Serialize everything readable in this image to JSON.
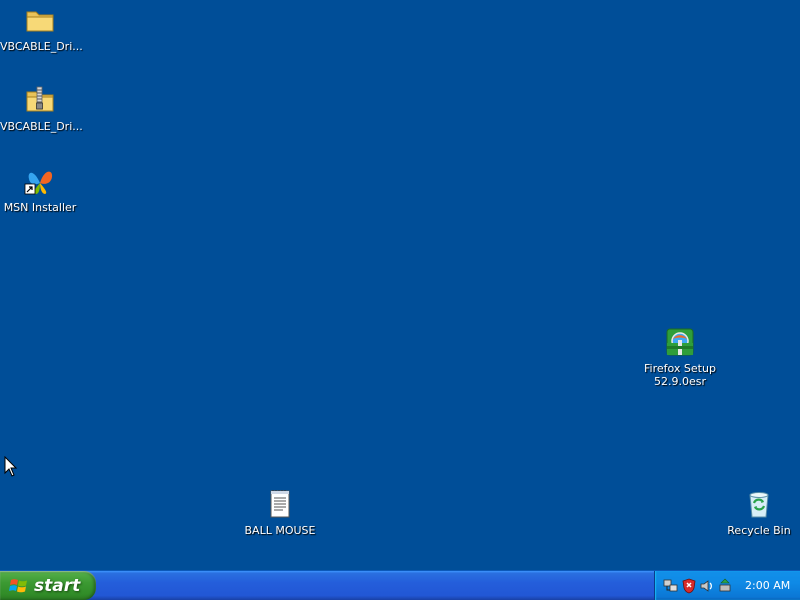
{
  "desktop": {
    "background_color": "#004e98",
    "icons": [
      {
        "label": "VBCABLE_Dri...",
        "icon": "folder-icon"
      },
      {
        "label": "VBCABLE_Dri...",
        "icon": "zip-folder-icon"
      },
      {
        "label": "MSN Installer",
        "icon": "msn-butterfly-shortcut-icon"
      },
      {
        "label": "Firefox Setup\n52.9.0esr",
        "icon": "installer-package-icon"
      },
      {
        "label": "BALL MOUSE",
        "icon": "text-document-icon"
      },
      {
        "label": "Recycle Bin",
        "icon": "recycle-bin-icon"
      }
    ]
  },
  "taskbar": {
    "start_label": "start",
    "clock": "2:00 AM",
    "tray_icons": [
      "network-icon",
      "security-shield-icon",
      "speaker-icon",
      "safely-remove-hardware-icon"
    ],
    "colors": {
      "taskbar": "#245edb",
      "start_button": "#3c9a33",
      "tray": "#0f8ae6"
    }
  }
}
